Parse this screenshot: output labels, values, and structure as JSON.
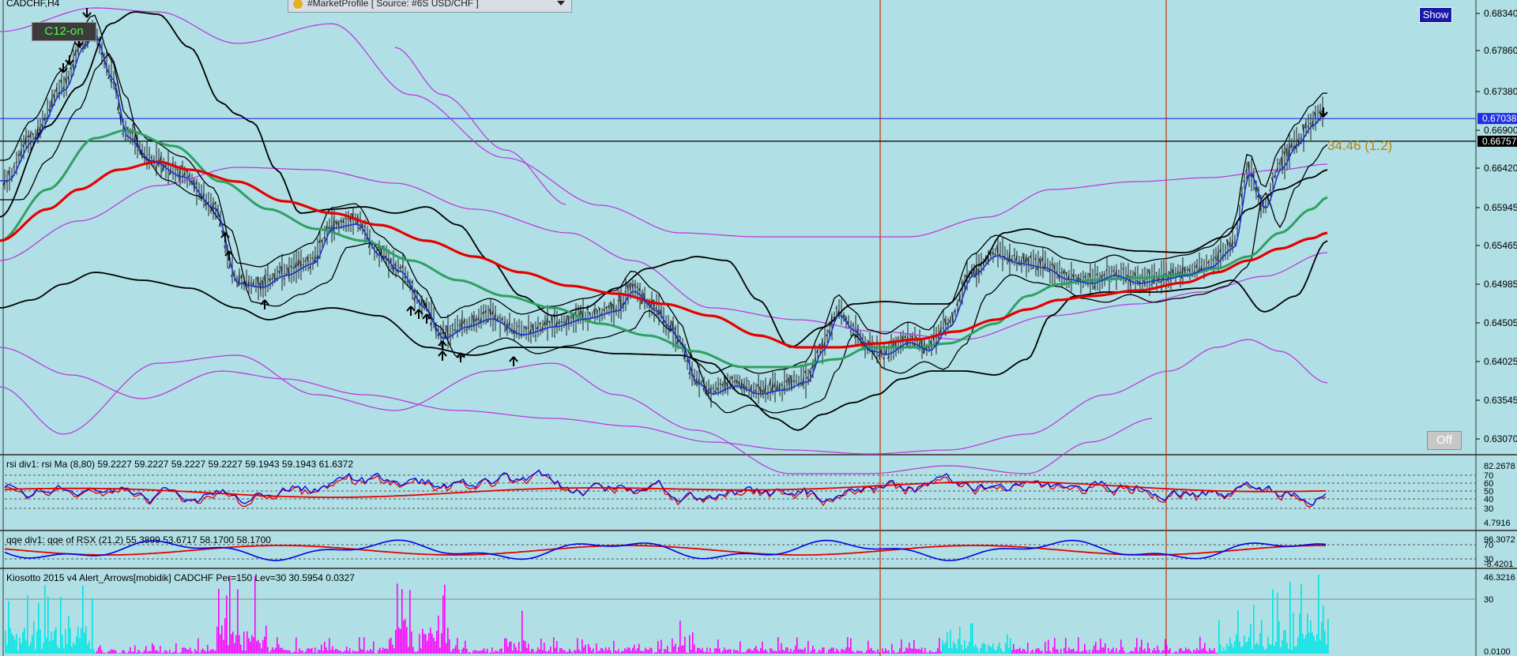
{
  "window": {
    "symbol_title": "CADCHF,H4"
  },
  "badges": {
    "c12": "C12-on",
    "show": "Show",
    "off": "Off"
  },
  "market_profile": {
    "select_label": "#MarketProfile [ Source: #6S USD/CHF ]"
  },
  "annotation": {
    "text": "34.46 (1.2)"
  },
  "price_axis": {
    "ticks": [
      "0.68340",
      "0.67860",
      "0.67380",
      "0.66900",
      "0.66420",
      "0.65945",
      "0.65465",
      "0.64985",
      "0.64505",
      "0.64025",
      "0.63545",
      "0.63070"
    ],
    "hline_labels": {
      "blue": "0.67038",
      "black": "0.66757"
    }
  },
  "panels": {
    "rsi": {
      "title": "rsi div1: rsi Ma (8,80) 59.2227 59.2227 59.2227 59.2227 59.1943 59.1943 61.6372",
      "levels": [
        "82.2678",
        "70",
        "60",
        "50",
        "40",
        "30",
        "4.7916"
      ]
    },
    "qqe": {
      "title": "qqe div1: qqe of RSX (21,2) 55.3899 53.6717 58.1700 58.1700",
      "levels": [
        "96.3072",
        "70",
        "30",
        "-8.4201"
      ]
    },
    "kiosotto": {
      "title": "Kiosotto 2015 v4 Alert_Arrows[mobidik] CADCHF Per=150 Lev=30 30.5954 0.0327",
      "levels": [
        "46.3216",
        "30",
        "0.0100"
      ]
    }
  },
  "colors": {
    "background": "#b0dfe5",
    "bullish": "#00e5e5",
    "bearish": "#ff00ff",
    "rsi_fast": "#0000e6",
    "rsi_slow": "#e60000",
    "ema_red": "#e60000",
    "ema_green": "#2ea060",
    "band_purple": "#bb33dd",
    "vline": "#c83200",
    "hline_blue": "#2030e0"
  },
  "chart_data": {
    "type": "line",
    "title": "CADCHF,H4",
    "yrange": [
      0.6307,
      0.6834
    ],
    "close_path_sample": [
      0.6625,
      0.672,
      0.679,
      0.676,
      0.666,
      0.661,
      0.658,
      0.654,
      0.651,
      0.6505,
      0.654,
      0.652,
      0.647,
      0.644,
      0.6465,
      0.6455,
      0.648,
      0.6465,
      0.642,
      0.638,
      0.639,
      0.644,
      0.6425,
      0.643,
      0.649,
      0.6535,
      0.6505,
      0.649,
      0.65,
      0.6505,
      0.651,
      0.6545,
      0.662,
      0.666,
      0.668
    ],
    "hlines": [
      0.67038,
      0.66757
    ]
  }
}
